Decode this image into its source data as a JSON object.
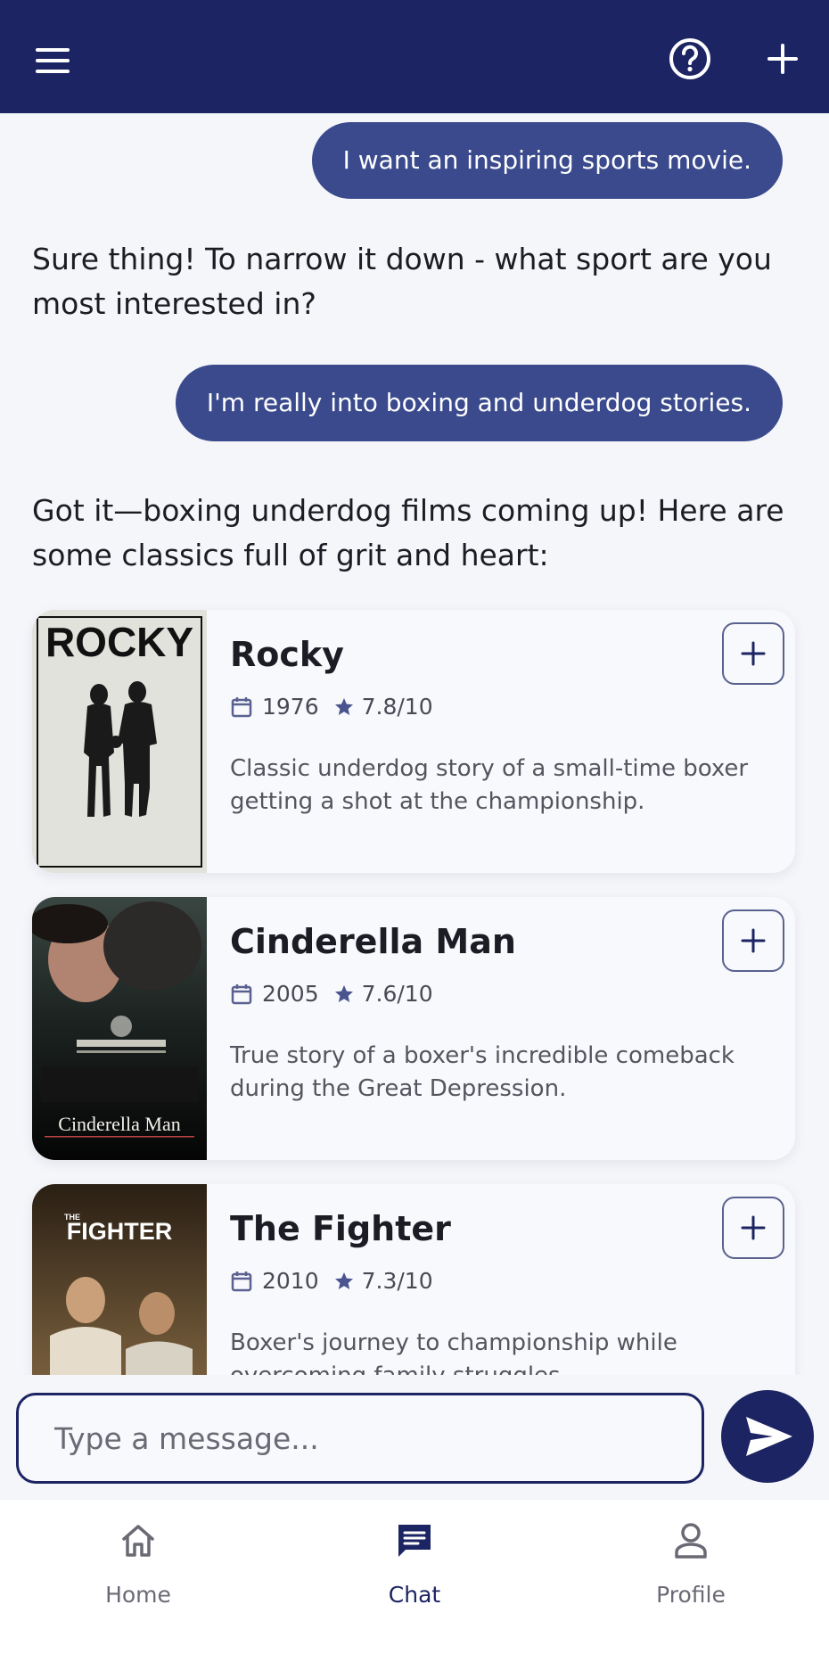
{
  "header": {
    "menu_icon": "hamburger-menu-icon",
    "help_icon": "help-circle-icon",
    "add_icon": "plus-icon",
    "background": "#1c2463"
  },
  "messages": [
    {
      "role": "user",
      "text": "I want an inspiring sports movie."
    },
    {
      "role": "assistant",
      "text": "Sure thing! To narrow it down - what sport are you most interested in?"
    },
    {
      "role": "user",
      "text": "I'm really into boxing and underdog stories."
    },
    {
      "role": "assistant",
      "text": "Got it—boxing underdog films coming up! Here are some classics full of grit and heart:"
    }
  ],
  "movies": [
    {
      "title": "Rocky",
      "year": "1976",
      "rating": "7.8/10",
      "description": "Classic underdog story of a small-time boxer getting a shot at the championship.",
      "poster_text": "ROCKY"
    },
    {
      "title": "Cinderella Man",
      "year": "2005",
      "rating": "7.6/10",
      "description": "True story of a boxer's incredible comeback during the Great Depression.",
      "poster_text": "Cinderella Man"
    },
    {
      "title": "The Fighter",
      "year": "2010",
      "rating": "7.3/10",
      "description": "Boxer's journey to championship while overcoming family struggles.",
      "poster_text_small": "THE",
      "poster_text": "FIGHTER"
    }
  ],
  "composer": {
    "placeholder": "Type a message...",
    "send_icon": "send-icon"
  },
  "bottom_nav": [
    {
      "label": "Home",
      "icon": "home-icon",
      "active": false
    },
    {
      "label": "Chat",
      "icon": "chat-icon",
      "active": true
    },
    {
      "label": "Profile",
      "icon": "profile-icon",
      "active": false
    }
  ],
  "colors": {
    "accent": "#1c2463",
    "user_bubble": "#3a4a8c",
    "background": "#f5f6fa"
  }
}
